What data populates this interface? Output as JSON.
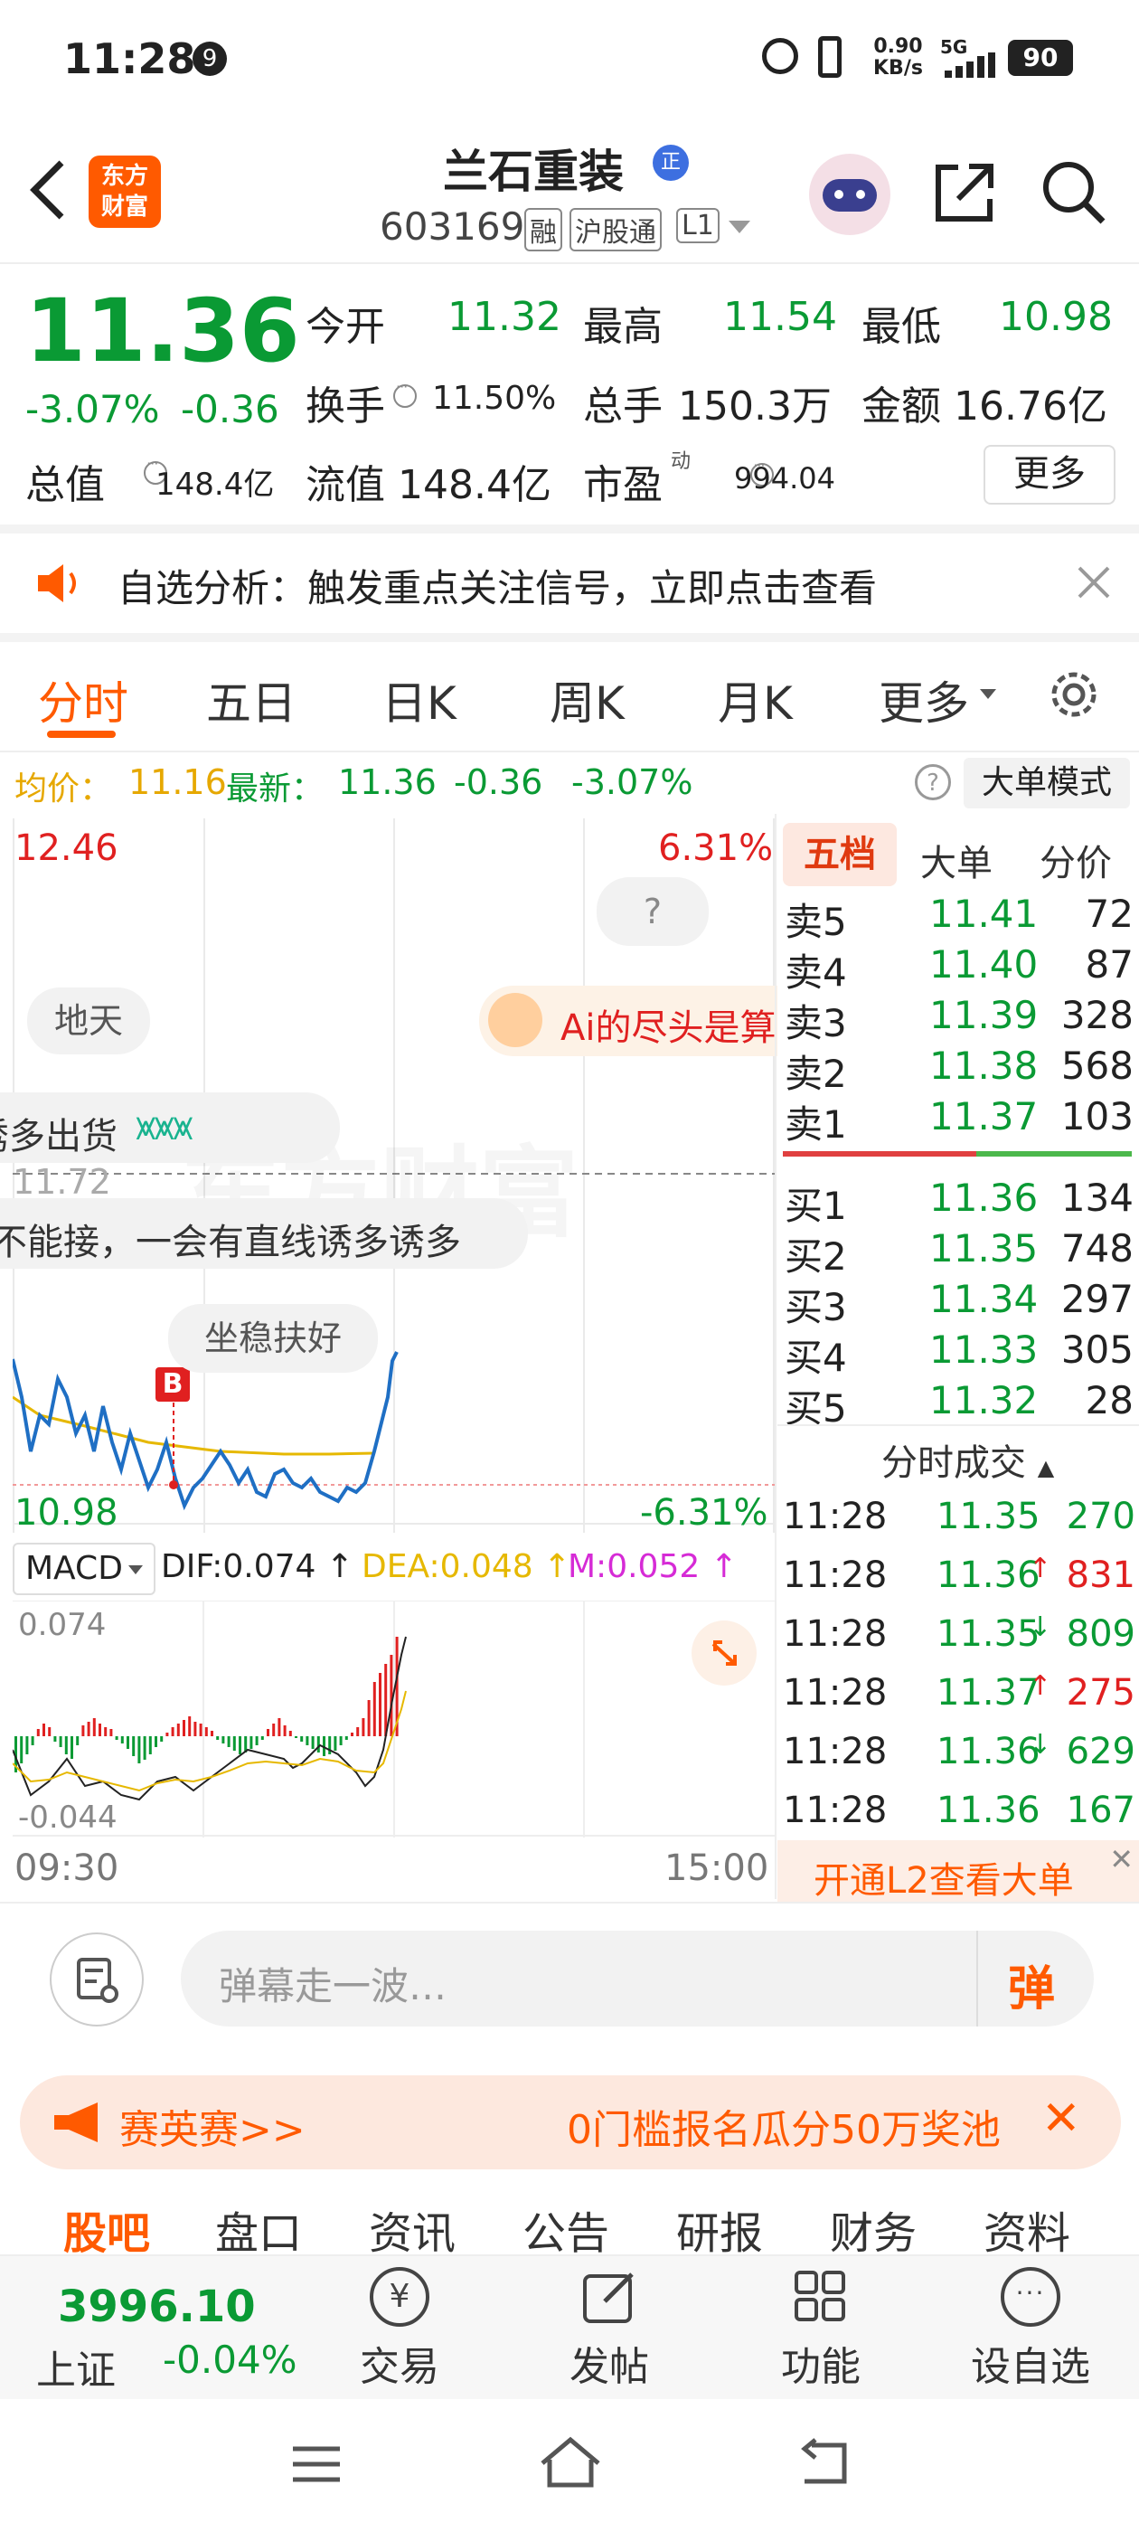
{
  "status_bar": {
    "time": "11:28",
    "notif": "9",
    "speed_top": "0.90",
    "speed_bottom": "KB/s",
    "net": "5G",
    "battery": "90"
  },
  "header": {
    "logo_line1": "东方",
    "logo_line2": "财富",
    "title": "兰石重装",
    "title_badge": "正",
    "code": "603169",
    "tags": [
      "融",
      "沪股通",
      "L1"
    ]
  },
  "quote": {
    "price": "11.36",
    "change_pct": "-3.07%",
    "change": "-0.36",
    "open_label": "今开",
    "open": "11.32",
    "high_label": "最高",
    "high": "11.54",
    "low_label": "最低",
    "low": "10.98",
    "turnover_label": "换手",
    "turnover": "11.50%",
    "volume_label": "总手",
    "volume": "150.3万",
    "amount_label": "金额",
    "amount": "16.76亿",
    "mcap_label": "总值",
    "mcap": "148.4亿",
    "float_label": "流值",
    "float": "148.4亿",
    "pe_label": "市盈",
    "pe_sup": "动",
    "pe": "994.04",
    "more_label": "更多"
  },
  "notice": {
    "text": "自选分析：触发重点关注信号，立即点击查看"
  },
  "chart_tabs": [
    "分时",
    "五日",
    "日K",
    "周K",
    "月K",
    "更多"
  ],
  "info_line": {
    "avg_label": "均价：",
    "avg": "11.16",
    "latest_label": "最新：",
    "latest": "11.36",
    "chg": "-0.36",
    "pct": "-3.07%",
    "mode_label": "大单模式"
  },
  "intraday": {
    "y_top": "12.46",
    "y_bottom": "10.98",
    "pct_top": "6.31%",
    "pct_bottom": "-6.31%",
    "ref_price": "11.72",
    "time_start": "09:30",
    "time_end": "15:00",
    "buy_marker": "B",
    "help_bubble": "?",
    "danmaku": [
      "地天",
      "Ai的尽头是算",
      "诱多出货",
      "不能接，一会有直线诱多诱多",
      "坐稳扶好"
    ],
    "watermark": "东方财富"
  },
  "macd": {
    "label": "MACD",
    "dif": "DIF:0.074",
    "dea": "DEA:0.048",
    "m": "M:0.052",
    "top": "0.074",
    "bottom": "-0.044"
  },
  "order_book": {
    "tabs": [
      "五档",
      "大单",
      "分价"
    ],
    "asks": [
      {
        "label": "卖5",
        "price": "11.41",
        "vol": "72"
      },
      {
        "label": "卖4",
        "price": "11.40",
        "vol": "87"
      },
      {
        "label": "卖3",
        "price": "11.39",
        "vol": "328"
      },
      {
        "label": "卖2",
        "price": "11.38",
        "vol": "568"
      },
      {
        "label": "卖1",
        "price": "11.37",
        "vol": "103"
      }
    ],
    "bids": [
      {
        "label": "买1",
        "price": "11.36",
        "vol": "134"
      },
      {
        "label": "买2",
        "price": "11.35",
        "vol": "748"
      },
      {
        "label": "买3",
        "price": "11.34",
        "vol": "297"
      },
      {
        "label": "买4",
        "price": "11.33",
        "vol": "305"
      },
      {
        "label": "买5",
        "price": "11.32",
        "vol": "28"
      }
    ],
    "trades_title": "分时成交",
    "trades": [
      {
        "time": "11:28",
        "price": "11.35",
        "arrow": "",
        "vol": "270",
        "vol_color": "green"
      },
      {
        "time": "11:28",
        "price": "11.36",
        "arrow": "↑",
        "vol": "831",
        "vol_color": "red"
      },
      {
        "time": "11:28",
        "price": "11.35",
        "arrow": "↓",
        "vol": "809",
        "vol_color": "green"
      },
      {
        "time": "11:28",
        "price": "11.37",
        "arrow": "↑",
        "vol": "275",
        "vol_color": "red"
      },
      {
        "time": "11:28",
        "price": "11.36",
        "arrow": "↓",
        "vol": "629",
        "vol_color": "green"
      },
      {
        "time": "11:28",
        "price": "11.36",
        "arrow": "",
        "vol": "167",
        "vol_color": "green"
      }
    ],
    "l2_banner": "开通L2查看大单"
  },
  "comment_bar": {
    "placeholder": "弹幕走一波…",
    "danmaku_btn": "弹"
  },
  "promo": {
    "left": "赛英赛>>",
    "right": "0门槛报名瓜分50万奖池"
  },
  "sub_tabs": [
    "股吧",
    "盘口",
    "资讯",
    "公告",
    "研报",
    "财务",
    "资料"
  ],
  "bottom_bar": {
    "index_value": "3996.10",
    "index_name": "上证",
    "index_chg": "-0.04%",
    "trade": "交易",
    "post": "发帖",
    "func": "功能",
    "watch": "设自选"
  },
  "colors": {
    "accent": "#ff5a00",
    "up": "#e02020",
    "down": "#0a9a34",
    "avg_line": "#e6b800",
    "price_line": "#1f6fc4"
  }
}
